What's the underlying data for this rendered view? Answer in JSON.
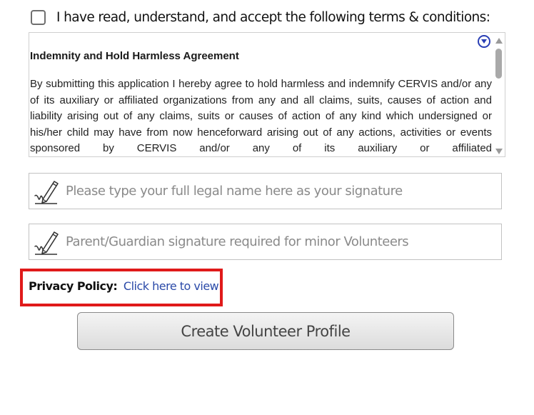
{
  "terms": {
    "accept_label": "I have read, understand, and accept the following terms & conditions:",
    "heading": "Indemnity and Hold Harmless Agreement",
    "body": "By submitting this application I hereby agree to hold harmless and indemnify CERVIS and/or any of its auxiliary or affiliated organizations from any and all claims, suits, causes of action and liability arising out of any claims, suits or causes of action of any kind which undersigned or his/her child may have from now henceforward arising out of any actions, activities or events sponsored by CERVIS and/or any of its auxiliary or affiliated",
    "checked": false
  },
  "signature": {
    "legal_name_placeholder": "Please type your full legal name here as your signature",
    "guardian_placeholder": "Parent/Guardian signature required for minor Volunteers"
  },
  "privacy": {
    "label": "Privacy Policy:",
    "link_text": "Click here to view"
  },
  "actions": {
    "create_label": "Create Volunteer Profile"
  },
  "colors": {
    "link": "#2b4aa8",
    "highlight": "#e01a1a",
    "expand_icon": "#2a3fb5"
  }
}
